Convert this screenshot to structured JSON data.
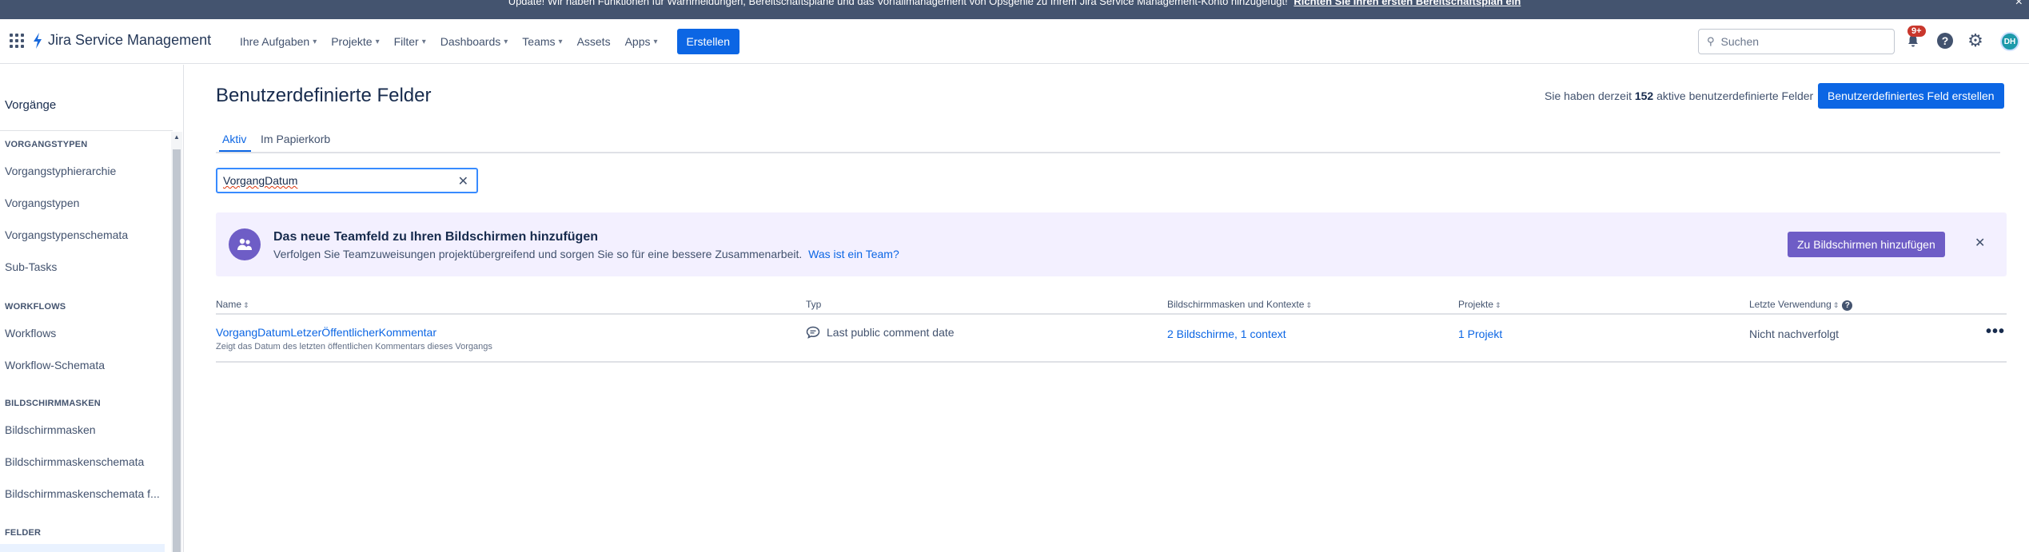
{
  "banner": {
    "text": "Update! Wir haben Funktionen für Warnmeldungen, Bereitschaftspläne und das Vorfallmanagement von Opsgenie zu Ihrem Jira Service Management-Konto hinzugefügt!",
    "link": "Richten Sie Ihren ersten Bereitschaftsplan ein",
    "close": "×"
  },
  "topnav": {
    "product": "Jira Service Management",
    "items": [
      {
        "label": "Ihre Aufgaben",
        "chevron": true
      },
      {
        "label": "Projekte",
        "chevron": true
      },
      {
        "label": "Filter",
        "chevron": true
      },
      {
        "label": "Dashboards",
        "chevron": true
      },
      {
        "label": "Teams",
        "chevron": true
      },
      {
        "label": "Assets",
        "chevron": false
      },
      {
        "label": "Apps",
        "chevron": true
      }
    ],
    "create_label": "Erstellen",
    "search_placeholder": "Suchen",
    "notification_badge": "9+",
    "help": "?",
    "avatar_initials": "DH"
  },
  "sidebar": {
    "title": "Vorgänge",
    "sections": [
      {
        "heading": "VORGANGSTYPEN",
        "items": [
          "Vorgangstyphierarchie",
          "Vorgangstypen",
          "Vorgangstypenschemata",
          "Sub-Tasks"
        ]
      },
      {
        "heading": "WORKFLOWS",
        "items": [
          "Workflows",
          "Workflow-Schemata"
        ]
      },
      {
        "heading": "BILDSCHIRMMASKEN",
        "items": [
          "Bildschirmmasken",
          "Bildschirmmaskenschemata",
          "Bildschirmmaskenschemata f..."
        ]
      },
      {
        "heading": "FELDER",
        "items": []
      }
    ]
  },
  "main": {
    "title": "Benutzerdefinierte Felder",
    "count_prefix": "Sie haben derzeit",
    "count_value": "152",
    "count_suffix": "aktive benutzerdefinierte Felder",
    "create_button": "Benutzerdefiniertes Feld erstellen",
    "tabs": [
      {
        "label": "Aktiv",
        "active": true
      },
      {
        "label": "Im Papierkorb",
        "active": false
      }
    ],
    "filter_value": "VorgangDatum",
    "promo": {
      "title": "Das neue Teamfeld zu Ihren Bildschirmen hinzufügen",
      "description": "Verfolgen Sie Teamzuweisungen projektübergreifend und sorgen Sie so für eine bessere Zusammenarbeit.",
      "link": "Was ist ein Team?",
      "button": "Zu Bildschirmen hinzufügen",
      "color": "#6e5dc6"
    },
    "table": {
      "headers": {
        "name": "Name",
        "type": "Typ",
        "screens": "Bildschirmmasken und Kontexte",
        "projects": "Projekte",
        "last_used": "Letzte Verwendung"
      },
      "rows": [
        {
          "name": "VorgangDatumLetzerÖffentlicherKommentar",
          "description": "Zeigt das Datum des letzten öffentlichen Kommentars dieses Vorgangs",
          "type": "Last public comment date",
          "type_icon": "comment-icon",
          "screens": "2 Bildschirme, 1 context",
          "projects": "1 Projekt",
          "last_used": "Nicht nachverfolgt"
        }
      ]
    }
  },
  "colors": {
    "primary": "#0c66e4",
    "banner": "#44546f",
    "promo_bg": "#f3f0ff",
    "badge": "#c9372c"
  }
}
